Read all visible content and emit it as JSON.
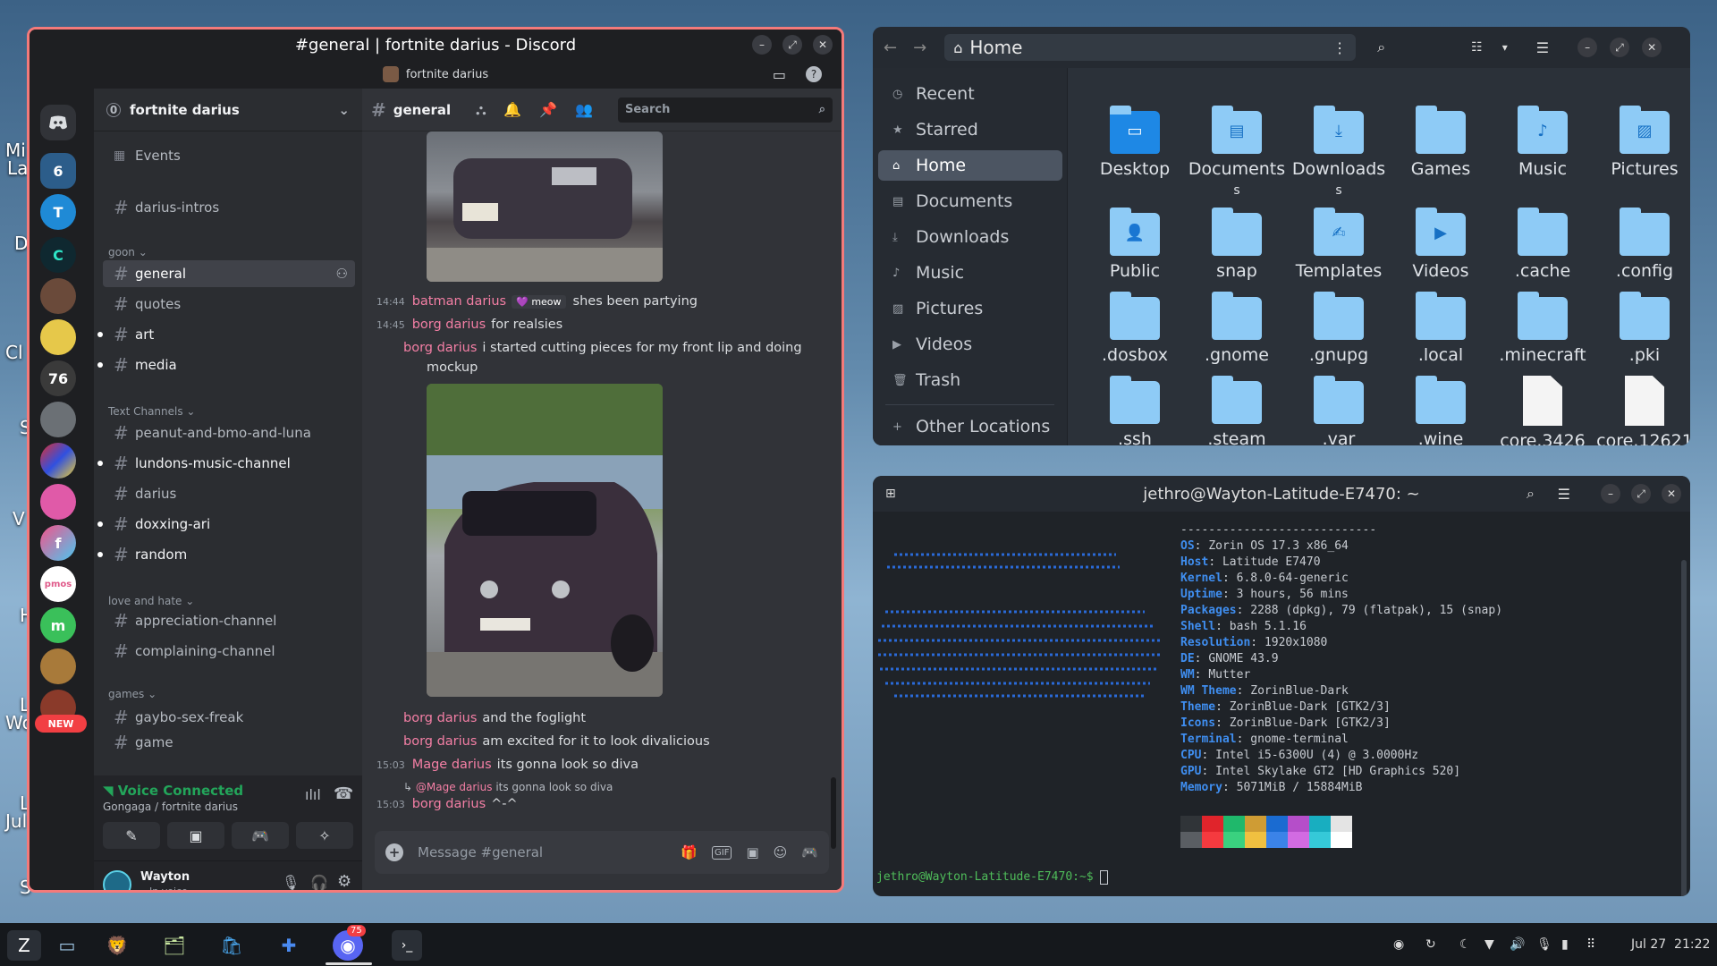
{
  "desktop": {
    "labels": [
      "Mi",
      "La",
      "D",
      "Cl",
      "S",
      "V",
      "H",
      "L",
      "Wo",
      "L",
      "Jul",
      "S"
    ]
  },
  "discord": {
    "title": "#general | fortnite darius - Discord",
    "server_name": "fortnite darius",
    "server_count": "0",
    "events_label": "Events",
    "channel_header": "general",
    "search_placeholder": "Search",
    "categories": [
      "goon",
      "Text Channels",
      "love and hate",
      "games"
    ],
    "channels": [
      "darius-intros",
      "general",
      "quotes",
      "art",
      "media",
      "peanut-and-bmo-and-luna",
      "lundons-music-channel",
      "darius",
      "doxxing-ari",
      "random",
      "appreciation-channel",
      "complaining-channel",
      "gaybo-sex-freak",
      "game"
    ],
    "new_badge": "NEW",
    "voice": {
      "status": "Voice Connected",
      "location": "Gongaga / fortnite darius"
    },
    "user": {
      "name": "Wayton",
      "status": "In voice"
    },
    "composer_placeholder": "Message #general",
    "messages": [
      {
        "time": "14:44",
        "author": "batman darius",
        "tag": "meow",
        "text": "shes been partying"
      },
      {
        "time": "14:45",
        "author": "borg darius",
        "text": "for realsies"
      },
      {
        "author": "borg darius",
        "text": "i started cutting pieces for my front lip and doing",
        "cont": "mockup"
      },
      {
        "author": "borg darius",
        "text": "and the foglight"
      },
      {
        "author": "borg darius",
        "text": "am excited for it to look divalicious"
      },
      {
        "time": "15:03",
        "author": "Mage darius",
        "text": "its gonna look so diva"
      },
      {
        "reply_to": "@Mage darius",
        "reply_text": "its gonna look so diva"
      },
      {
        "time": "15:03",
        "author": "borg darius",
        "text": "^-^"
      }
    ],
    "guild_icons": [
      "6",
      "T",
      "C",
      "",
      "",
      "76",
      "",
      "",
      "",
      "f",
      "pmos",
      "m",
      "",
      ""
    ],
    "colors": {
      "accent": "#f47a7a",
      "name": "#f47fa5",
      "voice": "#23a55a"
    }
  },
  "files": {
    "title": "Home",
    "sidebar": [
      "Recent",
      "Starred",
      "Home",
      "Documents",
      "Downloads",
      "Music",
      "Pictures",
      "Videos",
      "Trash",
      "Other Locations"
    ],
    "items": [
      "Desktop",
      "Documents",
      "Downloads",
      "Games",
      "Music",
      "Pictures",
      "Public",
      "snap",
      "Templates",
      "Videos",
      ".cache",
      ".config",
      ".dosbox",
      ".gnome",
      ".gnupg",
      ".local",
      ".minecraft",
      ".pki",
      ".ssh",
      ".steam",
      ".var",
      ".wine",
      "core.3426",
      "core.12621"
    ]
  },
  "terminal": {
    "title": "jethro@Wayton-Latitude-E7470: ~",
    "separator": "----------------------------",
    "info": [
      {
        "k": "OS",
        "v": "Zorin OS 17.3 x86_64"
      },
      {
        "k": "Host",
        "v": "Latitude E7470"
      },
      {
        "k": "Kernel",
        "v": "6.8.0-64-generic"
      },
      {
        "k": "Uptime",
        "v": "3 hours, 56 mins"
      },
      {
        "k": "Packages",
        "v": "2288 (dpkg), 79 (flatpak), 15 (snap)"
      },
      {
        "k": "Shell",
        "v": "bash 5.1.16"
      },
      {
        "k": "Resolution",
        "v": "1920x1080"
      },
      {
        "k": "DE",
        "v": "GNOME 43.9"
      },
      {
        "k": "WM",
        "v": "Mutter"
      },
      {
        "k": "WM Theme",
        "v": "ZorinBlue-Dark"
      },
      {
        "k": "Theme",
        "v": "ZorinBlue-Dark [GTK2/3]"
      },
      {
        "k": "Icons",
        "v": "ZorinBlue-Dark [GTK2/3]"
      },
      {
        "k": "Terminal",
        "v": "gnome-terminal"
      },
      {
        "k": "CPU",
        "v": "Intel i5-6300U (4) @ 3.0000Hz"
      },
      {
        "k": "GPU",
        "v": "Intel Skylake GT2 [HD Graphics 520]"
      },
      {
        "k": "Memory",
        "v": "5071MiB / 15884MiB"
      }
    ],
    "prompt": "jethro@Wayton-Latitude-E7470:~$ ",
    "palette_top": [
      "#303438",
      "#e0242b",
      "#1fb86b",
      "#cf9c34",
      "#1a6bd1",
      "#b54ec9",
      "#18aec0",
      "#e4e4e4"
    ],
    "palette_bottom": [
      "#5a5e63",
      "#f53a3f",
      "#3ad17f",
      "#f0c040",
      "#3b83e8",
      "#d26be2",
      "#35c9d8",
      "#ffffff"
    ]
  },
  "taskbar": {
    "discord_badge": "75",
    "datetime": "Jul 27  21:22"
  }
}
